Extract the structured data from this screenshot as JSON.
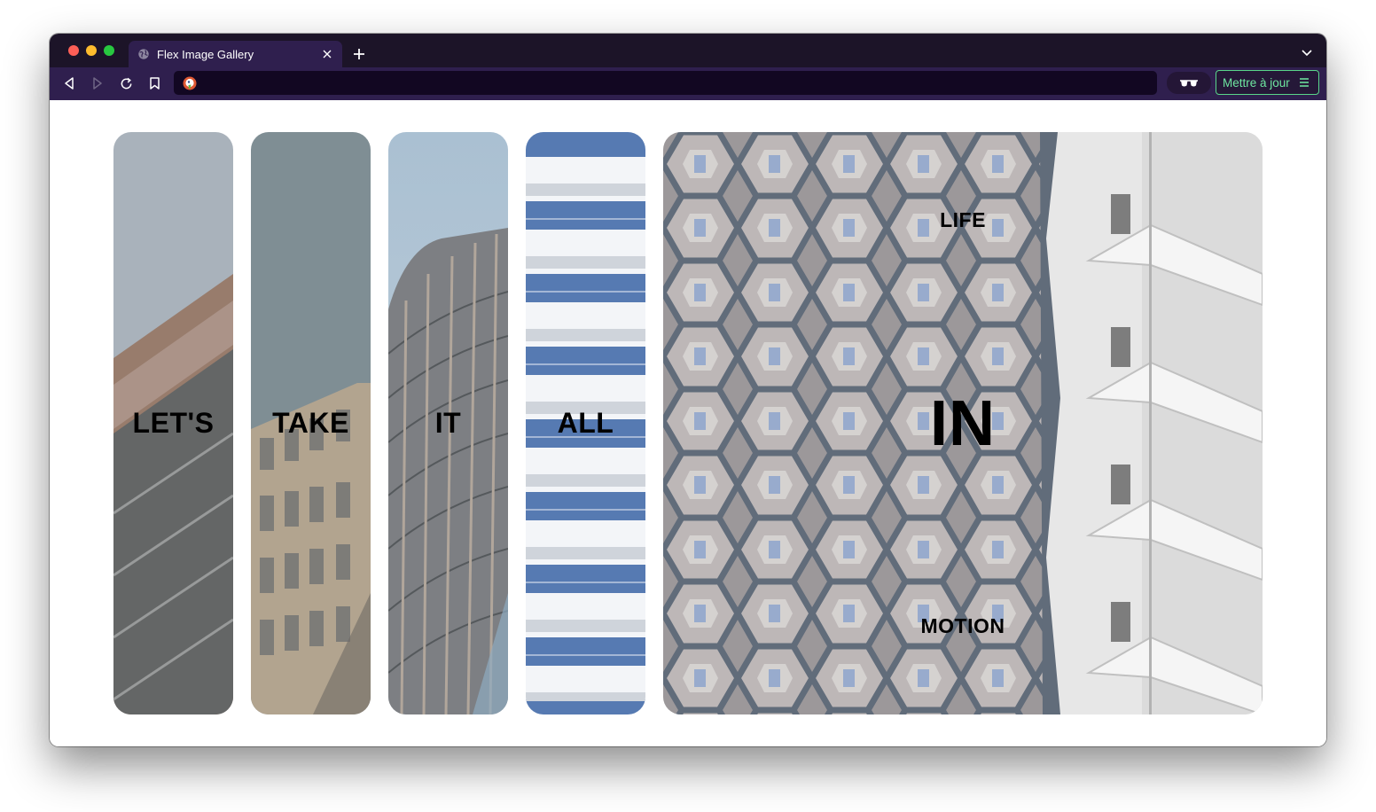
{
  "browser": {
    "tab_title": "Flex Image Gallery",
    "url": "",
    "update_button_label": "Mettre à jour",
    "icons": [
      "globe-icon",
      "close-icon",
      "plus-icon",
      "chevron-down-icon",
      "back-icon",
      "forward-icon",
      "reload-icon",
      "bookmark-icon",
      "duckduckgo-shield-icon",
      "glasses-icon",
      "menu-icon"
    ],
    "colors": {
      "tabbar": "#1c1428",
      "toolbar": "#2f1f4e",
      "url_bar": "#120722",
      "update_accent": "#6ee7a0"
    }
  },
  "gallery": {
    "panels": [
      {
        "words": [
          "LET'S"
        ]
      },
      {
        "words": [
          "TAKE"
        ]
      },
      {
        "words": [
          "IT"
        ]
      },
      {
        "words": [
          "ALL"
        ]
      },
      {
        "words": [
          "LIFE",
          "IN",
          "MOTION"
        ]
      }
    ]
  }
}
